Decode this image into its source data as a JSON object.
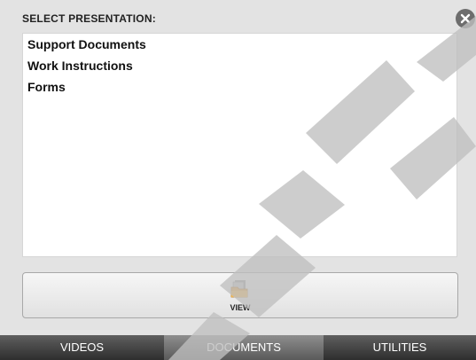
{
  "header": {
    "title": "SELECT PRESENTATION:"
  },
  "close_icon": "close-icon",
  "list": {
    "items": [
      {
        "label": "Support Documents"
      },
      {
        "label": "Work Instructions"
      },
      {
        "label": "Forms"
      }
    ]
  },
  "view_button": {
    "label": "VIEW",
    "icon": "folder-document-icon"
  },
  "tabs": [
    {
      "label": "VIDEOS",
      "active": false
    },
    {
      "label": "DOCUMENTS",
      "active": true
    },
    {
      "label": "UTILITIES",
      "active": false
    }
  ],
  "colors": {
    "panel_bg": "#e3e3e3",
    "tabbar_dark": "#3a3a3a",
    "tab_active": "#7a7a7a",
    "watermark": "#c8c8c8"
  }
}
